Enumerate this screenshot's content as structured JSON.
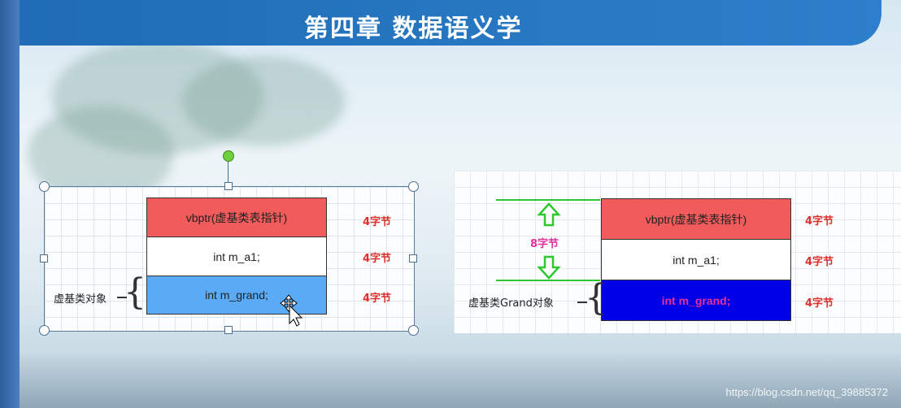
{
  "header": {
    "title": "第四章 数据语义学"
  },
  "left_diagram": {
    "rows": [
      {
        "text": "vbptr(虚基类表指针)",
        "size": "4字节",
        "color": "#f15b5b"
      },
      {
        "text": "int m_a1;",
        "size": "4字节",
        "color": "#ffffff"
      },
      {
        "text": "int m_grand;",
        "size": "4字节",
        "color": "#5aaaf5"
      }
    ],
    "object_label": "虚基类对象"
  },
  "right_diagram": {
    "rows": [
      {
        "text": "vbptr(虚基类表指针)",
        "size": "4字节",
        "color": "#f15b5b"
      },
      {
        "text": "int m_a1;",
        "size": "4字节",
        "color": "#ffffff"
      },
      {
        "text": "int m_grand;",
        "size": "4字节",
        "color": "#0000e6",
        "text_color": "#e0309c"
      }
    ],
    "offset_label": "8字节",
    "object_label": "虚基类Grand对象"
  },
  "watermark": "https://blog.csdn.net/qq_39885372",
  "colors": {
    "header": "#2272bf",
    "accent_red": "#e0302e",
    "green": "#2fc72f"
  }
}
